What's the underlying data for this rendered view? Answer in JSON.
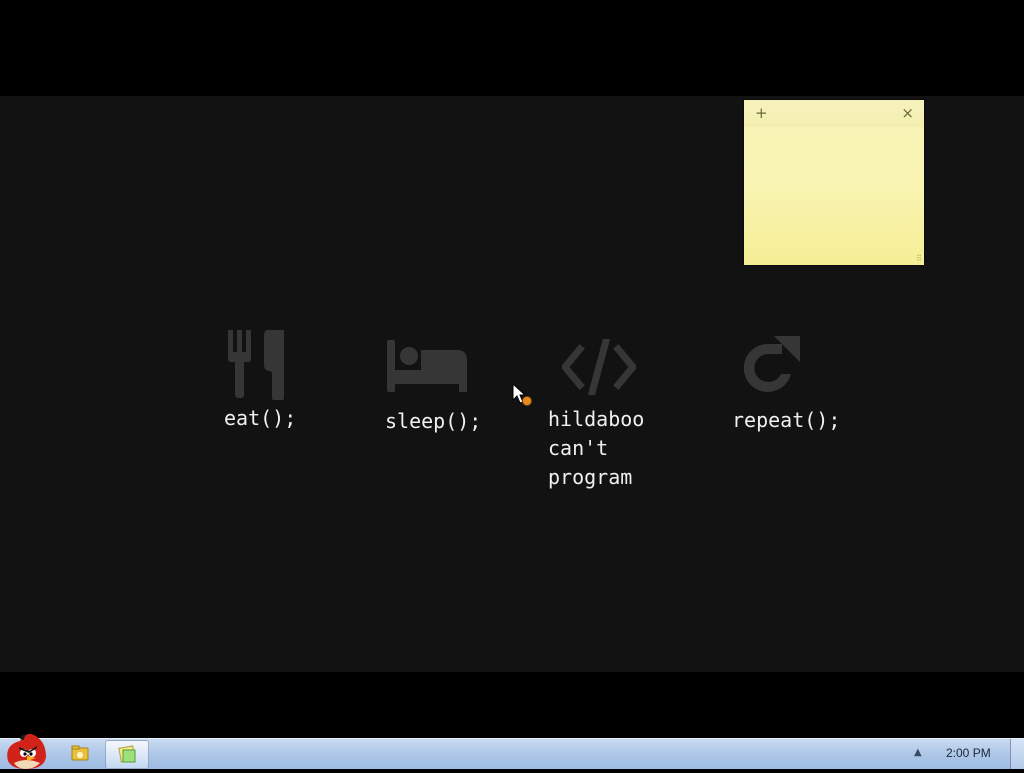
{
  "tiles": [
    {
      "icon": "fork-knife-icon",
      "label": "eat();"
    },
    {
      "icon": "bed-icon",
      "label": "sleep();"
    },
    {
      "icon": "code-icon",
      "label_lines": [
        "hildaboo",
        "can't",
        "program"
      ]
    },
    {
      "icon": "refresh-icon",
      "label": "repeat();"
    }
  ],
  "sticky_note": {
    "add_glyph": "+",
    "close_glyph": "×",
    "text": ""
  },
  "taskbar": {
    "start_icon": "angry-bird-icon",
    "pinned": [
      {
        "icon": "explorer-folder-icon",
        "active": false
      },
      {
        "icon": "sticky-notes-icon",
        "active": true
      }
    ],
    "tray_arrow": "▲",
    "clock": "2:00 PM"
  },
  "colors": {
    "wallpaper": "#121212",
    "icon_gray": "#363636",
    "sticky": "#f9f4b3"
  }
}
